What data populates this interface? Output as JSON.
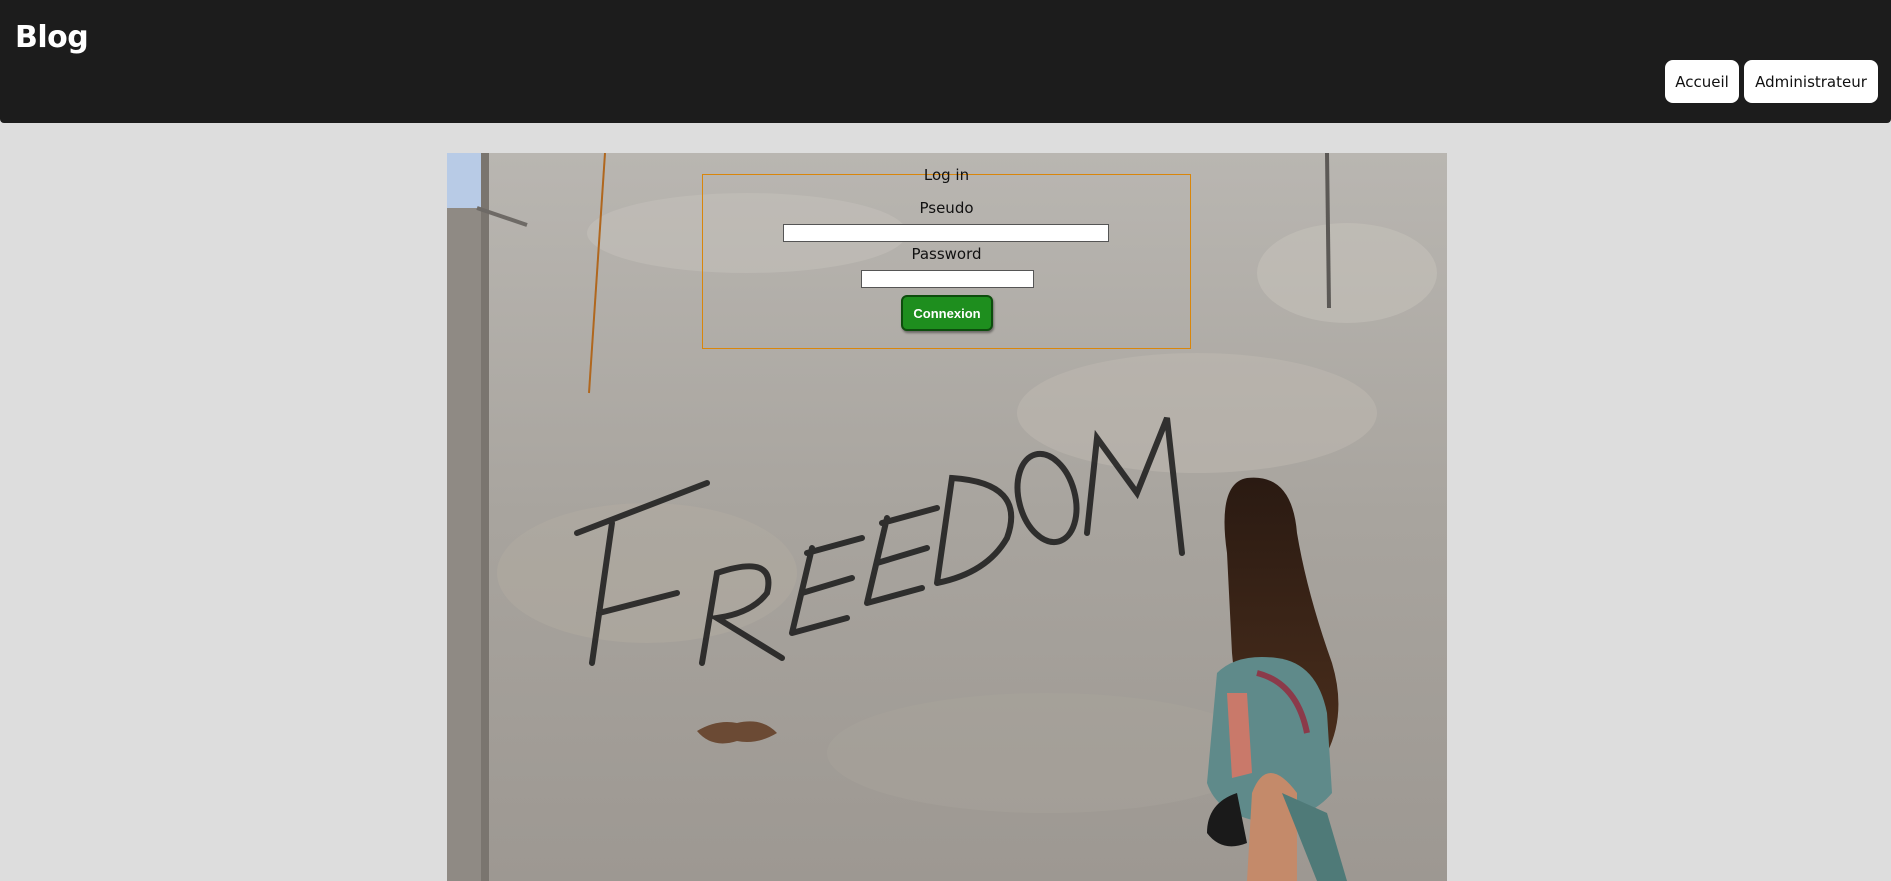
{
  "header": {
    "brand": "Blog",
    "nav": [
      {
        "label": "Accueil"
      },
      {
        "label": "Administrateur"
      }
    ]
  },
  "hero": {
    "graffiti_text": "FREEDOM"
  },
  "login": {
    "legend": "Log in",
    "pseudo_label": "Pseudo",
    "pseudo_value": "",
    "password_label": "Password",
    "password_value": "",
    "submit_label": "Connexion"
  },
  "colors": {
    "header_bg": "#1c1c1c",
    "page_bg": "#dddddd",
    "form_border": "#d9860b",
    "button_green": "#1e8e1e"
  }
}
